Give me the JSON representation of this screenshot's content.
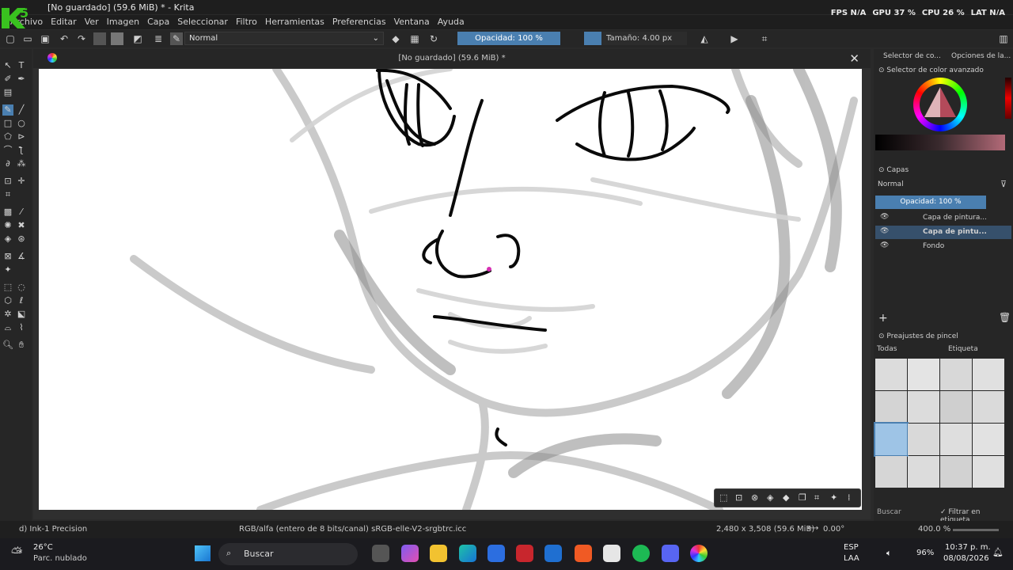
{
  "window": {
    "title": "[No guardado]  (59.6 MiB) * - Krita",
    "logo_text": "K5"
  },
  "perf_overlay": [
    {
      "label": "FPS",
      "value": "N/A"
    },
    {
      "label": "GPU",
      "value": "37 %"
    },
    {
      "label": "CPU",
      "value": "26 %"
    },
    {
      "label": "LAT",
      "value": "N/A"
    }
  ],
  "menu": [
    "Archivo",
    "Editar",
    "Ver",
    "Imagen",
    "Capa",
    "Seleccionar",
    "Filtro",
    "Herramientas",
    "Preferencias",
    "Ventana",
    "Ayuda"
  ],
  "toolbar": {
    "blend_mode": "Normal",
    "opacity": "Opacidad: 100 %",
    "size": "Tamaño: 4.00 px"
  },
  "document": {
    "tab_title": "[No guardado]  (59.6 MiB) *"
  },
  "right_panel": {
    "tabs": [
      "Selector de co...",
      "Opciones de la..."
    ],
    "color_selector_title": "Selector de color avanzado",
    "layers_title": "Capas",
    "layers_blend": "Normal",
    "layers_opacity": "Opacidad: 100 %",
    "layers": [
      {
        "name": "Capa de pintura...",
        "selected": false
      },
      {
        "name": "Capa de pintu...",
        "selected": true
      },
      {
        "name": "Fondo",
        "selected": false
      }
    ],
    "presets_title": "Preajustes de pincel",
    "presets_filter": "Todas",
    "presets_tag": "Etiqueta",
    "presets_search": "Buscar",
    "filter_in_tag": "Filtrar en etiqueta"
  },
  "status": {
    "brush": "d) Ink-1 Precision",
    "color_profile": "RGB/alfa (entero de 8 bits/canal)  sRGB-elle-V2-srgbtrc.icc",
    "dimensions": "2,480 x 3,508 (59.6 MiB)",
    "rotation": "0.00°",
    "zoom": "400.0 %"
  },
  "taskbar": {
    "weather_temp": "26°C",
    "weather_desc": "Parc. nublado",
    "search_label": "Buscar",
    "lang_top": "ESP",
    "lang_bottom": "LAA",
    "battery": "96%",
    "time": "10:37 p. m.",
    "date": "08/08/2026"
  }
}
